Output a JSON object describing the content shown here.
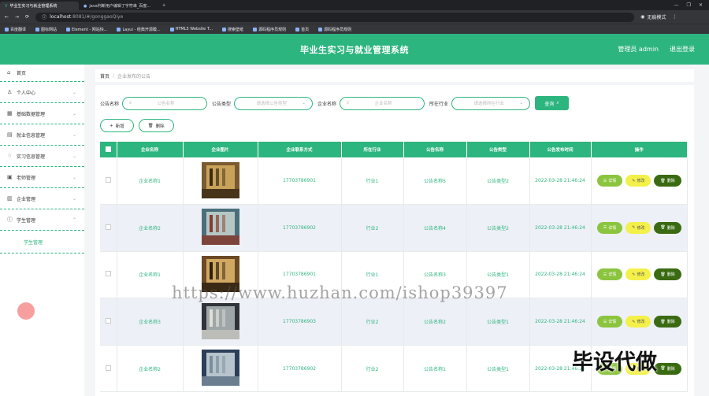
{
  "browser": {
    "tabs": [
      {
        "title": "毕业生实习与就业管理系统",
        "active": true
      },
      {
        "title": "java判断用户编辑了字符串_百度...",
        "active": false
      }
    ],
    "address": {
      "host": "localhost",
      "rest": ":8081/#/gonggaoQiye"
    },
    "profile": "无痕模式",
    "bookmarks": [
      "百度翻译",
      "图标网站",
      "Element - 网站快...",
      "Layui - 经典开源模...",
      "HTML5 Website T...",
      "搜索壁纸",
      "源码程序员规则",
      "首页",
      "源码程序员规则"
    ]
  },
  "header": {
    "title": "毕业生实习与就业管理系统",
    "admin": "管理员 admin",
    "logout": "退出登录"
  },
  "sidebar": {
    "items": [
      {
        "label": "首页",
        "icon": "home-icon"
      },
      {
        "label": "个人中心",
        "icon": "user-icon"
      },
      {
        "label": "基础数据管理",
        "icon": "grid-icon"
      },
      {
        "label": "就业信息管理",
        "icon": "briefcase-icon"
      },
      {
        "label": "实习信息管理",
        "icon": "bell-icon"
      },
      {
        "label": "老师管理",
        "icon": "teacher-icon"
      },
      {
        "label": "企业管理",
        "icon": "building-icon"
      },
      {
        "label": "学生管理",
        "icon": "info-icon"
      }
    ],
    "sub_item": "学生管理"
  },
  "breadcrumb": {
    "home": "首页",
    "sep": "/",
    "current": "企业发布的公告"
  },
  "filters": {
    "title_label": "公告名称",
    "title_ph": "公告名称",
    "type_label": "公告类型",
    "type_ph": "请选择公告类型",
    "company_label": "企业名称",
    "company_ph": "企业名称",
    "industry_label": "所在行业",
    "industry_ph": "请选择所在行业",
    "search": "查询"
  },
  "actions": {
    "add": "新增",
    "delete": "删除"
  },
  "table": {
    "headers": [
      "企业名称",
      "企业图片",
      "企业联系方式",
      "所在行业",
      "公告名称",
      "公告类型",
      "公告发布时间",
      "操作"
    ],
    "rows": [
      {
        "company": "企业名称1",
        "phone": "17703786901",
        "industry": "行业1",
        "title": "公告名称5",
        "type": "公告类型2",
        "time": "2022-03-28 21:46:24"
      },
      {
        "company": "企业名称2",
        "phone": "17703786902",
        "industry": "行业2",
        "title": "公告名称4",
        "type": "公告类型2",
        "time": "2022-03-28 21:46:24"
      },
      {
        "company": "企业名称1",
        "phone": "17703786901",
        "industry": "行业1",
        "title": "公告名称3",
        "type": "公告类型1",
        "time": "2022-03-28 21:46:24"
      },
      {
        "company": "企业名称3",
        "phone": "17703786903",
        "industry": "行业2",
        "title": "公告名称2",
        "type": "公告类型1",
        "time": "2022-03-28 21:46:24"
      },
      {
        "company": "企业名称2",
        "phone": "17703786902",
        "industry": "行业2",
        "title": "公告名称1",
        "type": "公告类型1",
        "time": "2022-03-28 21:46:24"
      }
    ],
    "ops": {
      "detail": "详情",
      "edit": "修改",
      "delete": "删除"
    }
  },
  "watermark": "https://www.huzhan.com/ishop39397",
  "overlay_text": "毕设代做",
  "colors": {
    "primary": "#2db57f",
    "detail": "#8bc53f",
    "edit": "#f4f04a",
    "remove": "#3a6b12"
  }
}
